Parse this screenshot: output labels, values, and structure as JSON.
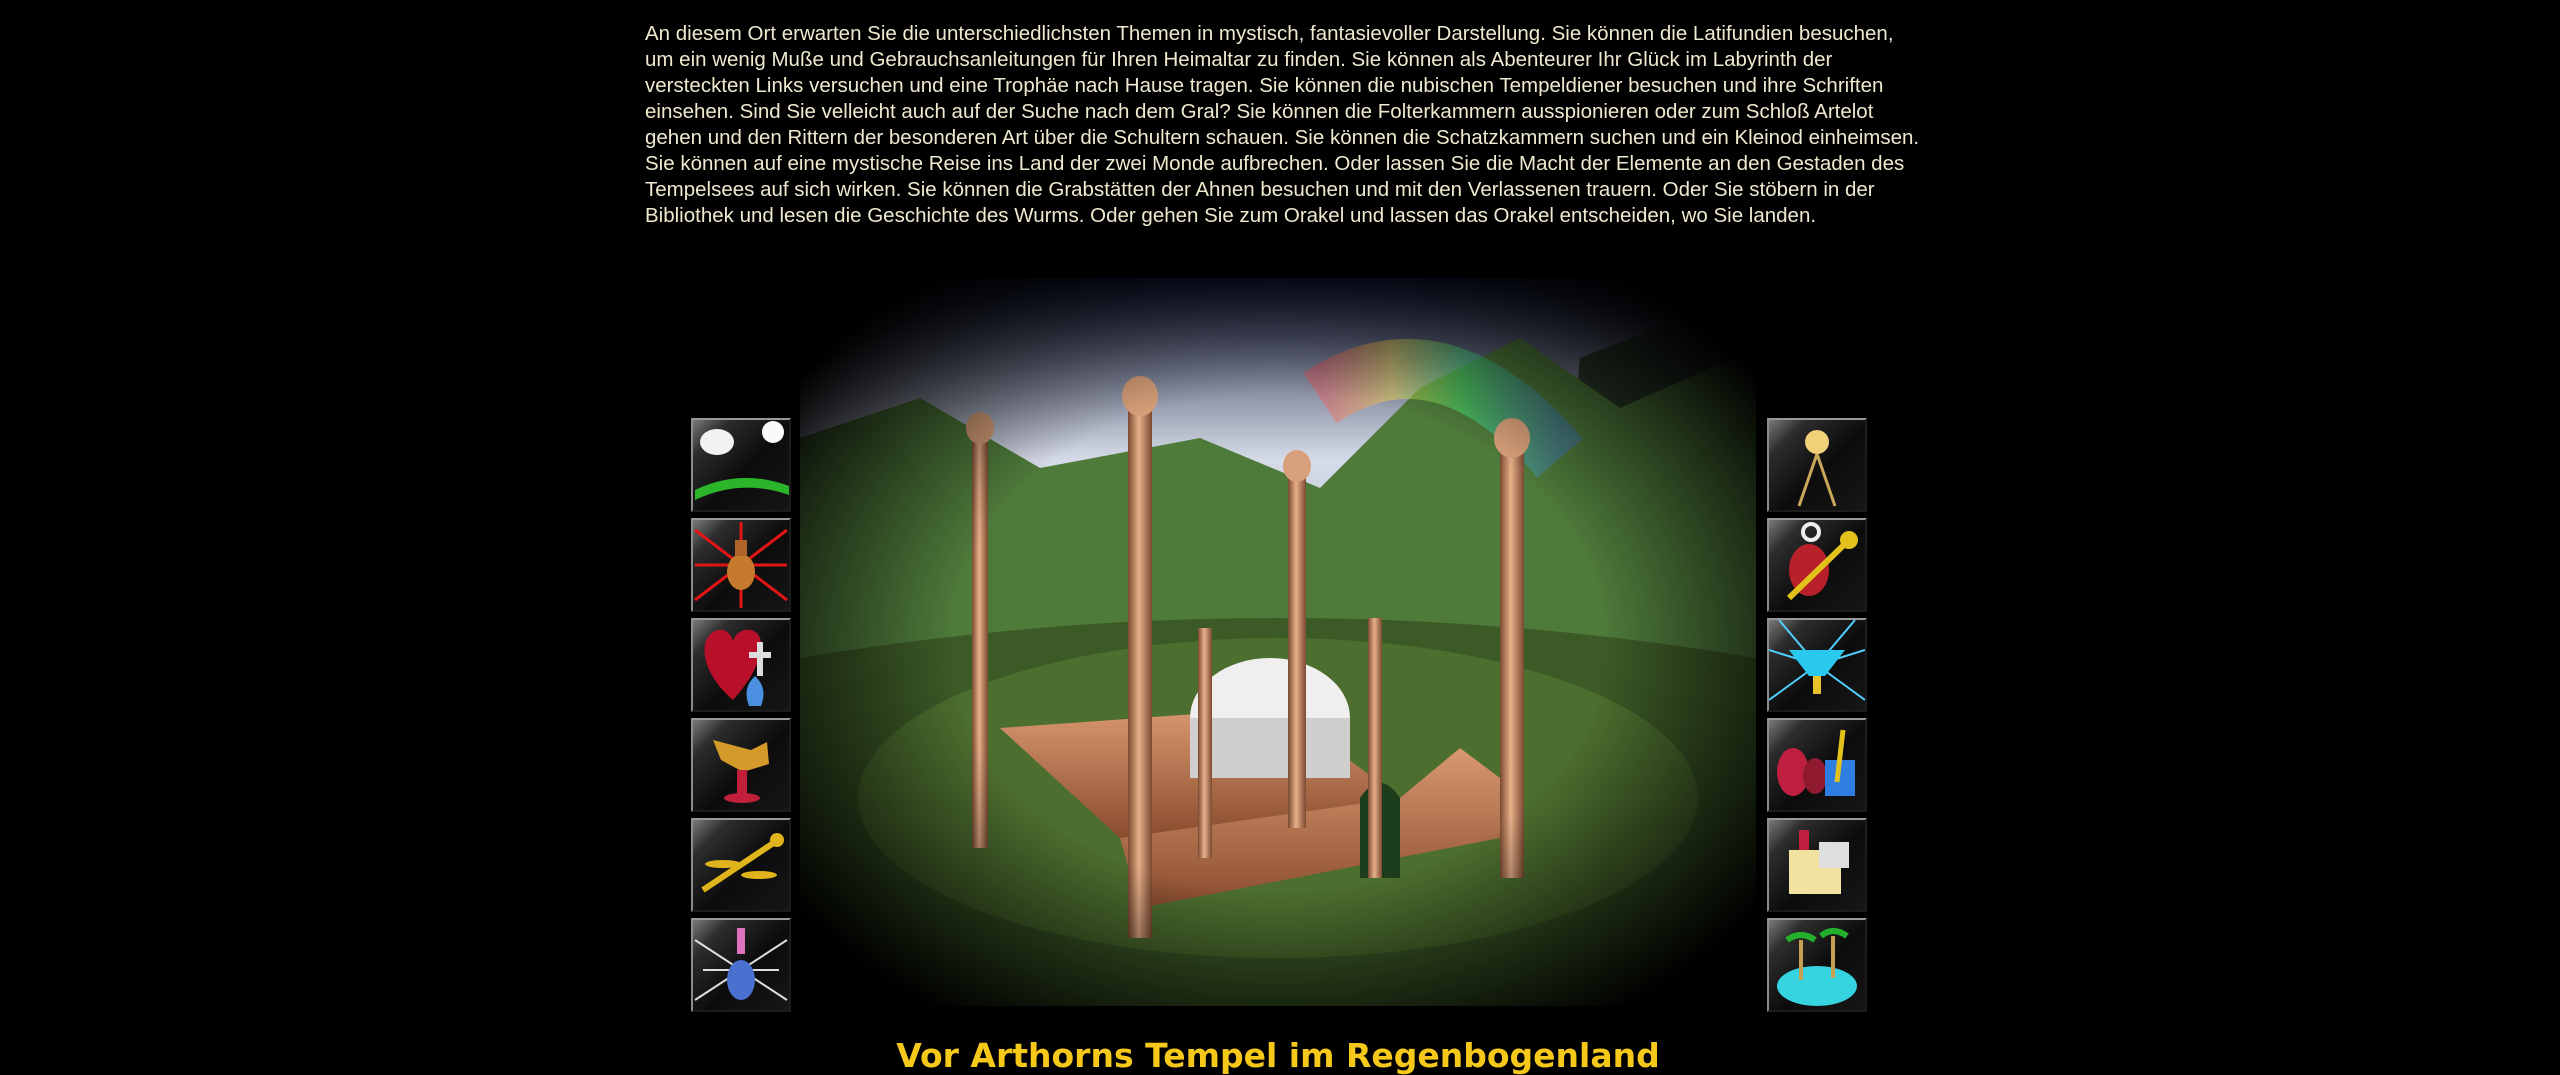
{
  "intro": {
    "text": "An diesem Ort erwarten Sie die unterschiedlichsten Themen in mystisch, fantasievoller Darstellung. Sie können die Latifundien besuchen, um ein wenig Muße und Gebrauchsanleitungen für Ihren Heimaltar zu finden. Sie können als Abenteurer Ihr Glück im Labyrinth der versteckten Links versuchen und eine Trophäe nach Hause tragen. Sie können die nubischen Tempeldiener besuchen und ihre Schriften einsehen. Sind Sie velleicht auch auf der Suche nach dem Gral? Sie können die Folterkammern ausspionieren oder zum Schloß Artelot gehen und den Rittern der besonderen Art über die Schultern schauen. Sie können die Schatzkammern suchen und ein Kleinod einheimsen. Sie können auf eine mystische Reise ins Land der zwei Monde aufbrechen. Oder lassen Sie die Macht der Elemente an den Gestaden des Tempelsees auf sich wirken. Sie können die Grabstätten der Ahnen besuchen und mit den Verlassenen trauern. Oder Sie stöbern in der Bibliothek und lesen die Geschichte des Wurms. Oder gehen Sie zum Orakel und lassen das Orakel entscheiden, wo Sie landen."
  },
  "nav_left": [
    {
      "icon": "two-moons-icon"
    },
    {
      "icon": "red-starburst-vase-icon"
    },
    {
      "icon": "heart-cross-vase-icon"
    },
    {
      "icon": "golden-goblet-icon"
    },
    {
      "icon": "golden-key-icon"
    },
    {
      "icon": "blue-vase-rays-icon"
    }
  ],
  "nav_right": [
    {
      "icon": "golden-pendulum-icon"
    },
    {
      "icon": "amphora-key-icon"
    },
    {
      "icon": "cyan-chalice-icon"
    },
    {
      "icon": "vases-blue-gate-icon"
    },
    {
      "icon": "scroll-chest-icon"
    },
    {
      "icon": "island-palms-icon"
    }
  ],
  "caption": "Vor Arthorns Tempel im Regenbogenland",
  "colors": {
    "background": "#000000",
    "text": "#efe9cf",
    "caption": "#f6c81a"
  }
}
